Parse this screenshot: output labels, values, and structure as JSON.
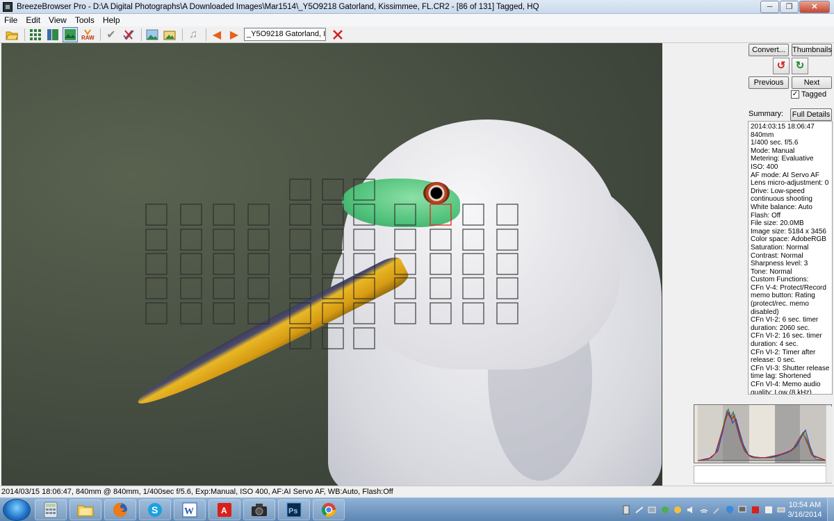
{
  "window": {
    "title": "BreezeBrowser Pro - D:\\A Digital Photographs\\A Downloaded Images\\Mar1514\\_Y5O9218  Gatorland, Kissimmee, FL.CR2 - [86 of 131] Tagged, HQ",
    "minimize": "─",
    "maximize": "❐",
    "close": "✕"
  },
  "menu": [
    "File",
    "Edit",
    "View",
    "Tools",
    "Help"
  ],
  "toolbar": {
    "open_icon": "open-folder-icon",
    "raw_label": "RAW",
    "file_combo_value": "_Y5O9218  Gatorland, I",
    "combo_arrow": "▼",
    "check": "✔",
    "prev_arrow": "◀",
    "next_arrow": "▶",
    "music": "♫",
    "delete": "✘",
    "grid": "▦",
    "pics": "▤"
  },
  "right_panel": {
    "convert_label": "Convert...",
    "thumbnails_label": "Thumbnails",
    "rotate_left": "↺",
    "rotate_right": "↻",
    "previous_label": "Previous",
    "next_label": "Next",
    "tagged_label": "Tagged",
    "tagged_check": "✓",
    "summary_label": "Summary:",
    "full_details_label": "Full Details"
  },
  "details_lines": [
    "2014:03:15 18:06:47",
    "840mm",
    "1/400 sec. f/5.6",
    "Mode: Manual",
    "Metering: Evaluative",
    "ISO: 400",
    "AF mode: AI Servo AF",
    "Lens micro-adjustment: 0",
    "Drive: Low-speed",
    "continuous shooting",
    "White balance: Auto",
    "Flash: Off",
    "File size: 20.0MB",
    "Image size: 5184 x 3456",
    "Color space: AdobeRGB",
    "Saturation: Normal",
    "Contrast: Normal",
    "Sharpness level: 3",
    "Tone: Normal",
    "Custom Functions:",
    "CFn V-4: Protect/Record",
    "memo button: Rating",
    "(protect/rec. memo",
    "disabled)",
    "CFn VI-2: 6 sec. timer",
    "duration: 2060 sec.",
    "CFn VI-2: 16 sec. timer",
    "duration: 4 sec.",
    "CFn VI-2: Timer after",
    "release: 0 sec.",
    "CFn VI-3: Shutter release",
    "time lag: Shortened",
    "CFn VI-4: Memo audio",
    "quality: Low (8 kHz)"
  ],
  "status_text": "2014/03/15 18:06:47, 840mm @ 840mm, 1/400sec f/5.6, Exp:Manual, ISO 400, AF:AI Servo AF, WB:Auto, Flash:Off",
  "taskbar": {
    "apps": [
      "calculator-icon",
      "explorer-icon",
      "firefox-icon",
      "skype-icon",
      "word-icon",
      "acrobat-icon",
      "camera-icon",
      "photoshop-icon",
      "chrome-icon"
    ],
    "skype": "S",
    "word": "W",
    "acrobat": "A",
    "ps": "Ps",
    "clock_time": "10:54 AM",
    "clock_date": "3/16/2014"
  },
  "colors": {
    "af_active": "#e0201a",
    "hist_red": "#d02020",
    "hist_green": "#209020",
    "hist_blue": "#2030d0"
  }
}
